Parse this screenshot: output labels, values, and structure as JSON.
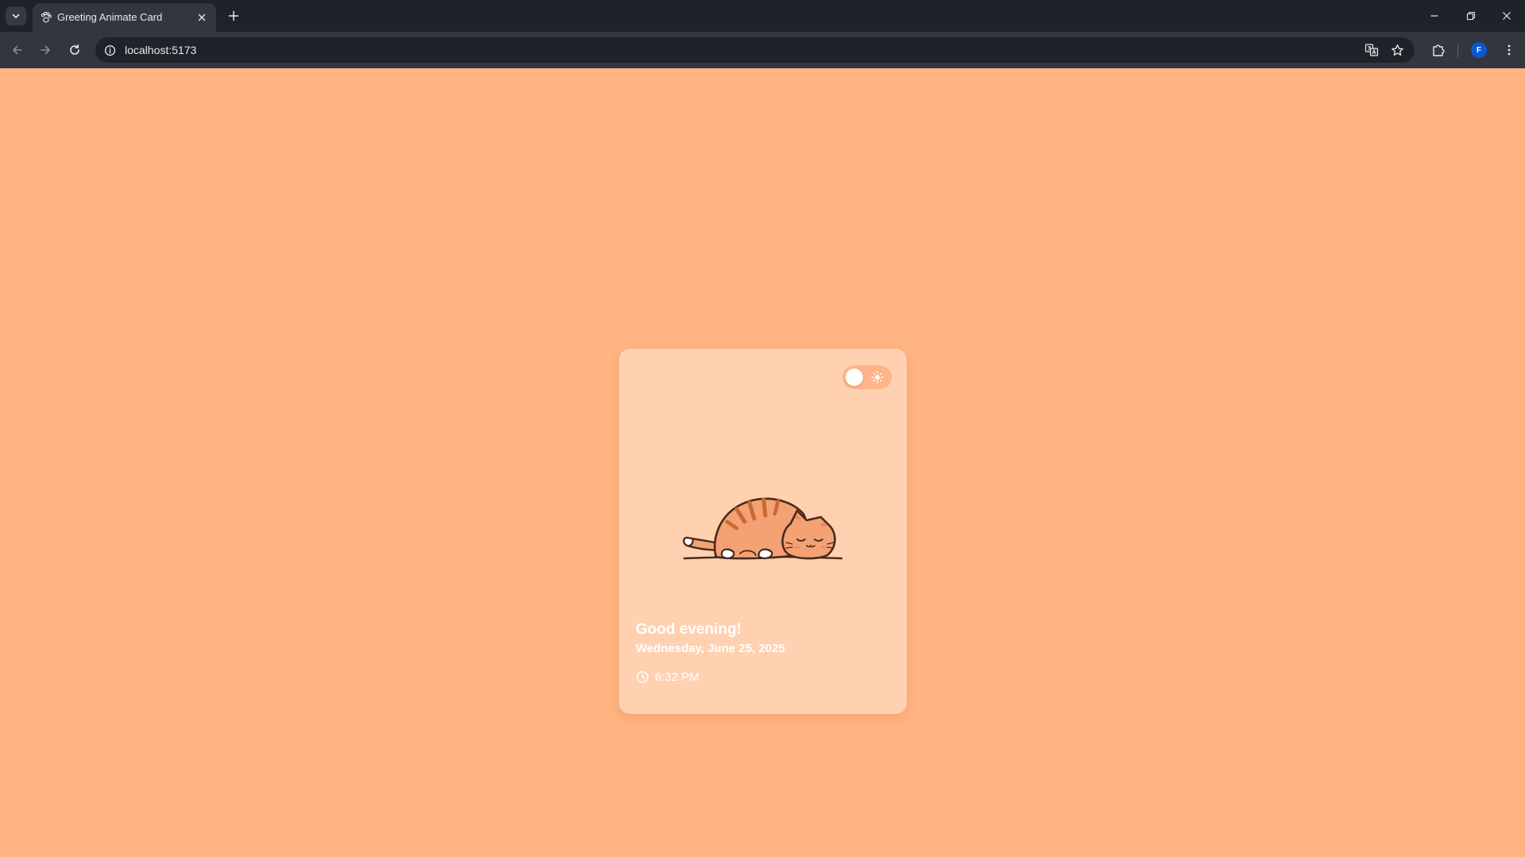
{
  "browser": {
    "tab_title": "Greeting Animate Card",
    "url": "localhost:5173",
    "profile_initial": "F",
    "icons": {
      "tab_search": "chevron-down-icon",
      "favicon": "paw-icon",
      "close_tab": "close-icon",
      "new_tab": "plus-icon",
      "back": "arrow-left-icon",
      "forward": "arrow-right-icon",
      "reload": "reload-icon",
      "site_info": "info-icon",
      "translate": "translate-icon",
      "bookmark": "star-icon",
      "extensions": "puzzle-icon",
      "menu": "kebab-menu-icon",
      "minimize": "minimize-icon",
      "restore": "restore-icon",
      "close_window": "close-icon"
    }
  },
  "page": {
    "background_color": "#ffb482",
    "card": {
      "background_color": "#ffd1b0",
      "theme_toggle": {
        "state": "light",
        "icon": "sun-icon"
      },
      "illustration": "sleeping-cat",
      "greeting": "Good evening!",
      "date": "Wednesday, June 25, 2025",
      "time": "6:32 PM",
      "time_icon": "clock-icon"
    }
  }
}
